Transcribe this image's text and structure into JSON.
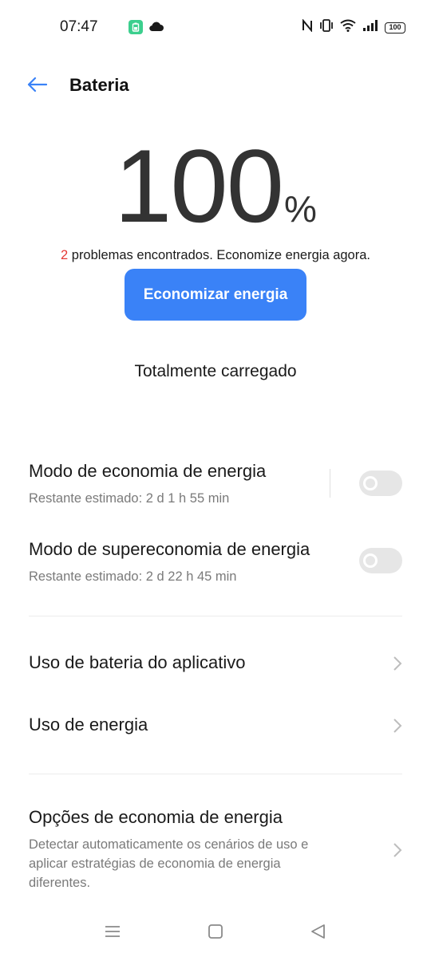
{
  "status_bar": {
    "time": "07:47",
    "battery_level": "100",
    "icons": [
      "battery-saver-notification-icon",
      "cloud-icon",
      "nfc-icon",
      "vibrate-icon",
      "wifi-icon",
      "signal-icon",
      "battery-icon"
    ]
  },
  "header": {
    "title": "Bateria",
    "back_icon": "arrow-left-icon"
  },
  "hero": {
    "percent": "100",
    "percent_sign": "%",
    "problems_count": "2",
    "problems_text": "problemas encontrados. Economize energia agora.",
    "action_button": "Economizar energia",
    "charge_status": "Totalmente carregado"
  },
  "settings": {
    "power_saving": {
      "title": "Modo de economia de energia",
      "estimate": "Restante estimado:  2 d 1 h 55 min",
      "enabled": false
    },
    "super_saving": {
      "title": "Modo de supereconomia de energia",
      "estimate": "Restante estimado:  2 d 22 h 45 min",
      "enabled": false
    },
    "app_usage": {
      "title": "Uso de bateria do aplicativo"
    },
    "energy_usage": {
      "title": "Uso de energia"
    },
    "saving_options": {
      "title": "Opções de economia de energia",
      "description": "Detectar automaticamente os cenários de uso e aplicar estratégias de economia de energia diferentes."
    }
  },
  "colors": {
    "accent": "#3a82f7",
    "problem_count": "#e53935",
    "toggle_off": "#e6e6e6",
    "secondary_text": "#7a7a7a"
  },
  "nav_bar": {
    "icons": [
      "menu-icon",
      "home-icon",
      "back-icon"
    ]
  }
}
